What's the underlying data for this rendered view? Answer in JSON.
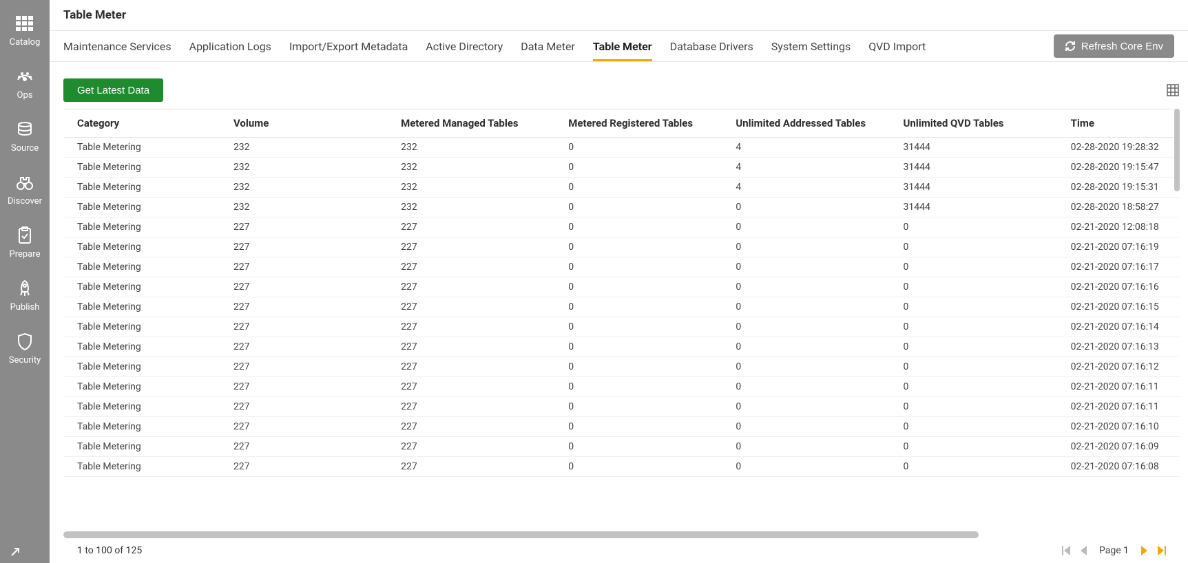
{
  "sidebar": {
    "items": [
      {
        "label": "Catalog",
        "icon": "catalog"
      },
      {
        "label": "Ops",
        "icon": "ops"
      },
      {
        "label": "Source",
        "icon": "source"
      },
      {
        "label": "Discover",
        "icon": "discover"
      },
      {
        "label": "Prepare",
        "icon": "prepare"
      },
      {
        "label": "Publish",
        "icon": "publish"
      },
      {
        "label": "Security",
        "icon": "security"
      }
    ]
  },
  "header": {
    "title": "Table Meter"
  },
  "tabs": [
    {
      "label": "Maintenance Services"
    },
    {
      "label": "Application Logs"
    },
    {
      "label": "Import/Export Metadata"
    },
    {
      "label": "Active Directory"
    },
    {
      "label": "Data Meter"
    },
    {
      "label": "Table Meter",
      "active": true
    },
    {
      "label": "Database Drivers"
    },
    {
      "label": "System Settings"
    },
    {
      "label": "QVD Import"
    }
  ],
  "actions": {
    "refresh": "Refresh Core Env",
    "getLatest": "Get Latest Data"
  },
  "table": {
    "columns": [
      "Category",
      "Volume",
      "Metered Managed Tables",
      "Metered Registered Tables",
      "Unlimited Addressed Tables",
      "Unlimited QVD Tables",
      "Time"
    ],
    "rows": [
      {
        "category": "Table Metering",
        "volume": "232",
        "mmt": "232",
        "mrt": "0",
        "uat": "4",
        "uqt": "31444",
        "time": "02-28-2020 19:28:32"
      },
      {
        "category": "Table Metering",
        "volume": "232",
        "mmt": "232",
        "mrt": "0",
        "uat": "4",
        "uqt": "31444",
        "time": "02-28-2020 19:15:47"
      },
      {
        "category": "Table Metering",
        "volume": "232",
        "mmt": "232",
        "mrt": "0",
        "uat": "4",
        "uqt": "31444",
        "time": "02-28-2020 19:15:31"
      },
      {
        "category": "Table Metering",
        "volume": "232",
        "mmt": "232",
        "mrt": "0",
        "uat": "0",
        "uqt": "31444",
        "time": "02-28-2020 18:58:27"
      },
      {
        "category": "Table Metering",
        "volume": "227",
        "mmt": "227",
        "mrt": "0",
        "uat": "0",
        "uqt": "0",
        "time": "02-21-2020 12:08:18"
      },
      {
        "category": "Table Metering",
        "volume": "227",
        "mmt": "227",
        "mrt": "0",
        "uat": "0",
        "uqt": "0",
        "time": "02-21-2020 07:16:19"
      },
      {
        "category": "Table Metering",
        "volume": "227",
        "mmt": "227",
        "mrt": "0",
        "uat": "0",
        "uqt": "0",
        "time": "02-21-2020 07:16:17"
      },
      {
        "category": "Table Metering",
        "volume": "227",
        "mmt": "227",
        "mrt": "0",
        "uat": "0",
        "uqt": "0",
        "time": "02-21-2020 07:16:16"
      },
      {
        "category": "Table Metering",
        "volume": "227",
        "mmt": "227",
        "mrt": "0",
        "uat": "0",
        "uqt": "0",
        "time": "02-21-2020 07:16:15"
      },
      {
        "category": "Table Metering",
        "volume": "227",
        "mmt": "227",
        "mrt": "0",
        "uat": "0",
        "uqt": "0",
        "time": "02-21-2020 07:16:14"
      },
      {
        "category": "Table Metering",
        "volume": "227",
        "mmt": "227",
        "mrt": "0",
        "uat": "0",
        "uqt": "0",
        "time": "02-21-2020 07:16:13"
      },
      {
        "category": "Table Metering",
        "volume": "227",
        "mmt": "227",
        "mrt": "0",
        "uat": "0",
        "uqt": "0",
        "time": "02-21-2020 07:16:12"
      },
      {
        "category": "Table Metering",
        "volume": "227",
        "mmt": "227",
        "mrt": "0",
        "uat": "0",
        "uqt": "0",
        "time": "02-21-2020 07:16:11"
      },
      {
        "category": "Table Metering",
        "volume": "227",
        "mmt": "227",
        "mrt": "0",
        "uat": "0",
        "uqt": "0",
        "time": "02-21-2020 07:16:11"
      },
      {
        "category": "Table Metering",
        "volume": "227",
        "mmt": "227",
        "mrt": "0",
        "uat": "0",
        "uqt": "0",
        "time": "02-21-2020 07:16:10"
      },
      {
        "category": "Table Metering",
        "volume": "227",
        "mmt": "227",
        "mrt": "0",
        "uat": "0",
        "uqt": "0",
        "time": "02-21-2020 07:16:09"
      },
      {
        "category": "Table Metering",
        "volume": "227",
        "mmt": "227",
        "mrt": "0",
        "uat": "0",
        "uqt": "0",
        "time": "02-21-2020 07:16:08"
      }
    ]
  },
  "footer": {
    "rangeText": "1 to 100 of 125",
    "pageLabel": "Page 1"
  }
}
